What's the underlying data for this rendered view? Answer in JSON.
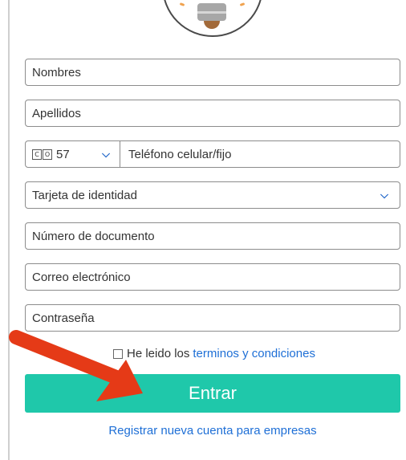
{
  "form": {
    "nombres_placeholder": "Nombres",
    "apellidos_placeholder": "Apellidos",
    "country_flag_letters": [
      "C",
      "O"
    ],
    "country_code": "57",
    "phone_placeholder": "Teléfono celular/fijo",
    "document_type_selected": "Tarjeta de identidad",
    "document_number_placeholder": "Número de documento",
    "email_placeholder": "Correo electrónico",
    "password_placeholder": "Contraseña",
    "terms_prefix": "He leido los",
    "terms_link": "terminos y condiciones",
    "submit_label": "Entrar",
    "register_link": "Registrar nueva cuenta para empresas"
  },
  "icons": {
    "dropdown": "chevron-down-icon",
    "logo": "lightbulb-logo",
    "annotation": "red-arrow"
  },
  "colors": {
    "primary_button": "#1fc8aa",
    "link": "#1e6fd6",
    "annotation_arrow": "#e53a17"
  }
}
